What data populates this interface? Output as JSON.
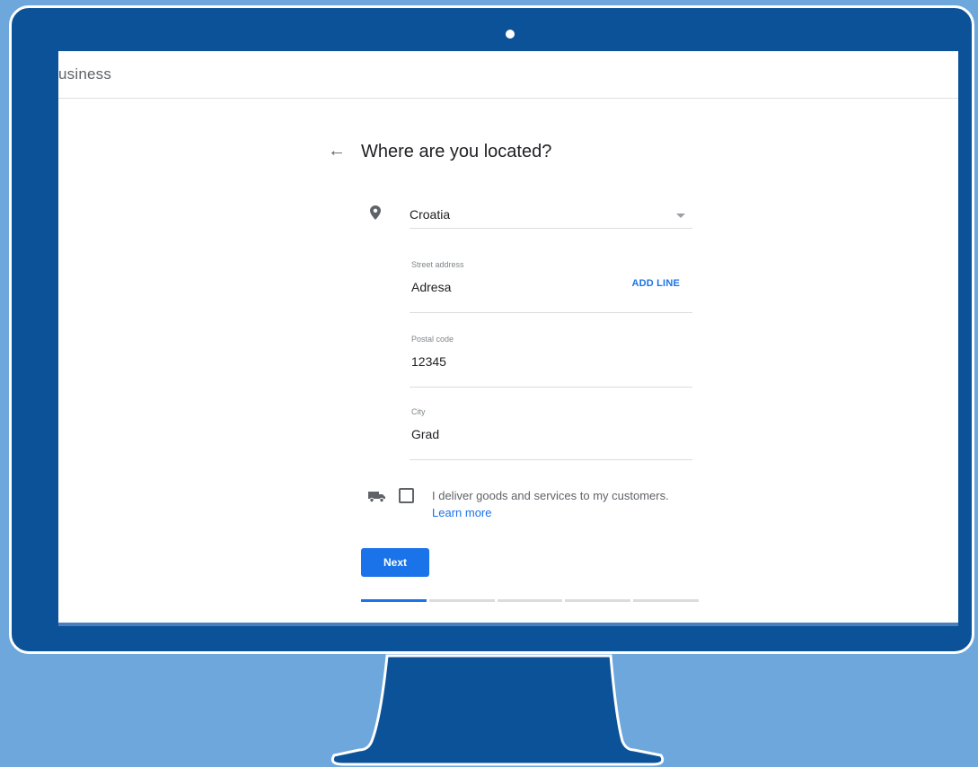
{
  "header": {
    "brand_text": "usiness"
  },
  "form": {
    "title": "Where are you located?",
    "back_icon": "arrow-back-icon",
    "country": {
      "value": "Croatia",
      "icon": "location-pin-icon"
    },
    "street_address": {
      "label": "Street address",
      "value": "Adresa",
      "add_line_label": "ADD LINE"
    },
    "postal_code": {
      "label": "Postal code",
      "value": "12345"
    },
    "city": {
      "label": "City",
      "value": "Grad"
    },
    "delivery": {
      "icon": "truck-icon",
      "text": "I deliver goods and services to my customers.",
      "link": "Learn more",
      "checked": false
    },
    "next_label": "Next",
    "progress": {
      "total_steps": 5,
      "current_step": 1
    }
  },
  "colors": {
    "accent": "#1a73e8",
    "monitor": "#0c5299",
    "background": "#6ea7dc"
  }
}
